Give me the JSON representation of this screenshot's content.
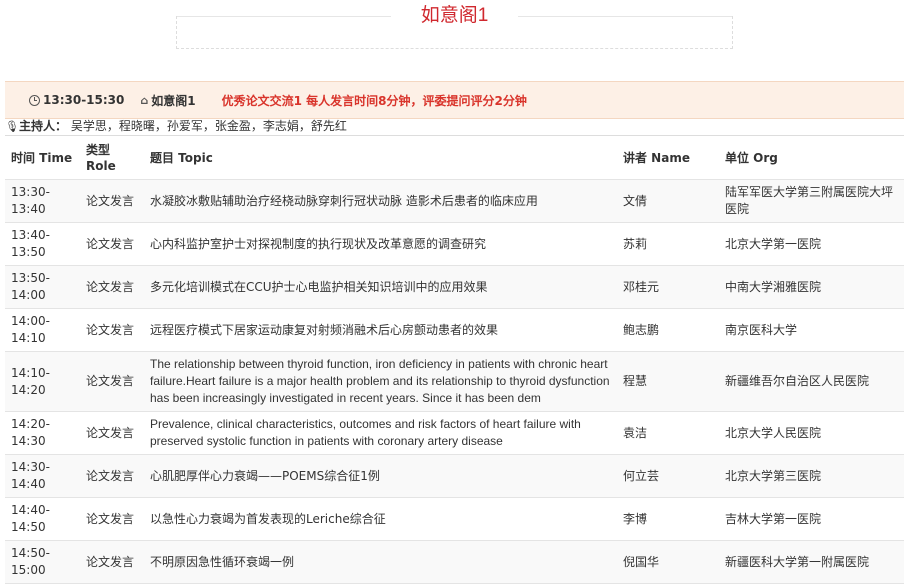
{
  "hall": {
    "title": "如意阁1"
  },
  "session": {
    "time": "13:30-15:30",
    "room": "如意阁1",
    "description": "优秀论文交流1 每人发言时间8分钟，评委提问评分2分钟"
  },
  "hosts": {
    "label": "主持人：",
    "names": "吴学思，程晓曙，孙爱军，张金盈，李志娟，舒先红"
  },
  "table": {
    "headers": {
      "time": "时间 Time",
      "role": "类型 Role",
      "topic": "题目 Topic",
      "speaker": "讲者 Name",
      "org": "单位 Org"
    },
    "rows": [
      {
        "time": "13:30-13:40",
        "role": "论文发言",
        "topic": "水凝胶冰敷贴辅助治疗经桡动脉穿刺行冠状动脉 造影术后患者的临床应用",
        "speaker": "文倩",
        "org": "陆军军医大学第三附属医院大坪医院"
      },
      {
        "time": "13:40-13:50",
        "role": "论文发言",
        "topic": "心内科监护室护士对探视制度的执行现状及改革意愿的调查研究",
        "speaker": "苏莉",
        "org": "北京大学第一医院"
      },
      {
        "time": "13:50-14:00",
        "role": "论文发言",
        "topic": "多元化培训模式在CCU护士心电监护相关知识培训中的应用效果",
        "speaker": "邓桂元",
        "org": "中南大学湘雅医院"
      },
      {
        "time": "14:00-14:10",
        "role": "论文发言",
        "topic": "远程医疗模式下居家运动康复对射频消融术后心房颤动患者的效果",
        "speaker": "鲍志鹏",
        "org": "南京医科大学"
      },
      {
        "time": "14:10-14:20",
        "role": "论文发言",
        "topic": "The relationship between thyroid function, iron deficiency in patients with chronic heart failure.Heart failure is a major health problem and its relationship to thyroid dysfunction has been increasingly investigated in recent years. Since it has been dem",
        "speaker": "程慧",
        "org": "新疆维吾尔自治区人民医院"
      },
      {
        "time": "14:20-14:30",
        "role": "论文发言",
        "topic": "Prevalence, clinical characteristics, outcomes and risk factors of heart failure with preserved systolic function in patients with coronary artery disease",
        "speaker": "袁洁",
        "org": "北京大学人民医院"
      },
      {
        "time": "14:30-14:40",
        "role": "论文发言",
        "topic": "心肌肥厚伴心力衰竭——POEMS综合征1例",
        "speaker": "何立芸",
        "org": "北京大学第三医院"
      },
      {
        "time": "14:40-14:50",
        "role": "论文发言",
        "topic": "以急性心力衰竭为首发表现的Leriche综合征",
        "speaker": "李博",
        "org": "吉林大学第一医院"
      },
      {
        "time": "14:50-15:00",
        "role": "论文发言",
        "topic": "不明原因急性循环衰竭一例",
        "speaker": "倪国华",
        "org": "新疆医科大学第一附属医院"
      }
    ]
  },
  "colors": {
    "accent": "#d0282e",
    "session_bg": "#fdf0e6"
  }
}
